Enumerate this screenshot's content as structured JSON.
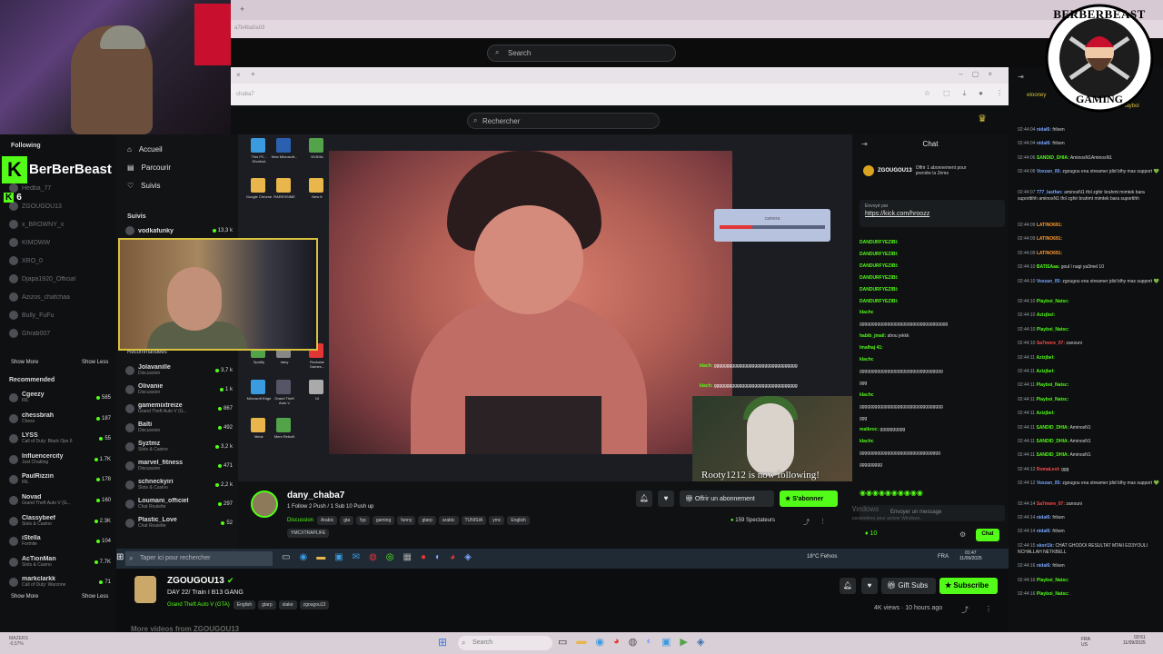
{
  "outer": {
    "search_placeholder": "Search",
    "addr_text": "a7b4ba0a03"
  },
  "inner": {
    "search_placeholder": "Rechercher",
    "addr_text": "chaba7"
  },
  "left_sidebar": {
    "following_title": "Following",
    "brand": "BerBerBeast",
    "brand_count": "6",
    "following": [
      {
        "name": "Hedba_77"
      },
      {
        "name": "ZGOUGOU13"
      },
      {
        "name": "x_BROWNY_x"
      },
      {
        "name": "KIMOWW"
      },
      {
        "name": "XRO_0"
      },
      {
        "name": "Djapa1920_Official"
      },
      {
        "name": "Azizos_chafchaa"
      },
      {
        "name": "Bully_FuFu"
      },
      {
        "name": "Ghrab007"
      }
    ],
    "show_more": "Show More",
    "show_less": "Show Less",
    "recommended_title": "Recommended",
    "recommended": [
      {
        "name": "Cgeezy",
        "sub": "IRL",
        "count": "585"
      },
      {
        "name": "chessbrah",
        "sub": "Chess",
        "count": "187"
      },
      {
        "name": "LYSS",
        "sub": "Call of Duty: Black Ops 6",
        "count": "55"
      },
      {
        "name": "Influencercity",
        "sub": "Just Chatting",
        "count": "1.7K"
      },
      {
        "name": "PaulRizzin",
        "sub": "IRL",
        "count": "178"
      },
      {
        "name": "Novad",
        "sub": "Grand Theft Auto V (G...",
        "count": "160"
      },
      {
        "name": "Classybeef",
        "sub": "Slots & Casino",
        "count": "2.3K"
      },
      {
        "name": "iStella",
        "sub": "Fortnite",
        "count": "104"
      },
      {
        "name": "AcTionMan",
        "sub": "Slots & Casino",
        "count": "7.7K"
      },
      {
        "name": "markclarkk",
        "sub": "Call of Duty: Warzone",
        "count": "71"
      }
    ],
    "show_more_2": "Show More",
    "show_less_2": "Show Less"
  },
  "mid_nav": {
    "items": [
      "Accueil",
      "Parcourir",
      "Suivis"
    ],
    "suivis_title": "Suivis",
    "first_channel": {
      "name": "vodkafunky",
      "count": "13,3 k"
    },
    "recommended_label": "Recommandées",
    "channels": [
      {
        "name": "Jolavanille",
        "sub": "Discussion",
        "count": "3,7 k"
      },
      {
        "name": "Olivanie",
        "sub": "Discussion",
        "count": "1 k"
      },
      {
        "name": "gamemixtreize",
        "sub": "Grand Theft Auto V (G...",
        "count": "867"
      },
      {
        "name": "Balti",
        "sub": "Discussion",
        "count": "492"
      },
      {
        "name": "Syztmz",
        "sub": "Slots & Casino",
        "count": "3,2 k"
      },
      {
        "name": "marvel_fitness",
        "sub": "Discussion",
        "count": "471"
      },
      {
        "name": "schneckyiri",
        "sub": "Slots & Casino",
        "count": "2,2 k"
      },
      {
        "name": "Loumani_officiel",
        "sub": "Chat Roulette",
        "count": "297"
      },
      {
        "name": "Plastic_Love",
        "sub": "Chat Roulette",
        "count": "52"
      }
    ]
  },
  "desktop_icons": [
    "This PC - Shortcut",
    "New Microsoft...",
    "NVIDIA",
    "Google Chrome",
    "RARESSIME",
    "New fr",
    "Spotify",
    "dany",
    "Rockstar Games...",
    "Microsoft Edge",
    "Grand Theft Auto V",
    "10",
    "tiktok",
    "Mem Rebuilt"
  ],
  "video_overlay": {
    "camera_label": "camera",
    "follow_text": "Rooty1212 is now following!",
    "chat_k1": "klach:",
    "chat_k2": "klach:"
  },
  "inner_chat": {
    "title": "Chat",
    "pinned_user": "ZGOUGOU13",
    "pinned_text": "Offrir 1 abonnement pour prendre la 2ème",
    "sent_by": "Envoyé par",
    "link": "https://kick.com/hroozz",
    "lines": [
      {
        "u": "DANDURFYEZIBI:",
        "t": ""
      },
      {
        "u": "DANDURFYEZIBI:",
        "t": ""
      },
      {
        "u": "DANDURFYEZIBI:",
        "t": ""
      },
      {
        "u": "DANDURFYEZIBI:",
        "t": ""
      },
      {
        "u": "DANDURFYEZIBI:",
        "t": ""
      },
      {
        "u": "DANDURFYEZIBI:",
        "t": ""
      },
      {
        "u": "klachc",
        "t": ""
      },
      {
        "u": "",
        "t": "ggggggggggggggggggggggggggggggggggg"
      },
      {
        "u": "habib_jmail:",
        "t": "ahou jekkk"
      },
      {
        "u": "lmalhaj 41:",
        "t": ""
      },
      {
        "u": "klachc",
        "t": ""
      },
      {
        "u": "",
        "t": "ggggggggggggggggggggggggggggggggg"
      },
      {
        "u": "",
        "t": "ggg"
      },
      {
        "u": "klachc",
        "t": ""
      },
      {
        "u": "",
        "t": "ggggggggggggggggggggggggggggggggg"
      },
      {
        "u": "",
        "t": "ggg"
      },
      {
        "u": "malbroc:",
        "t": "gggggggggg"
      },
      {
        "u": "klachc",
        "t": ""
      },
      {
        "u": "",
        "t": "gggggggggggggggggggggggggggggggg"
      },
      {
        "u": "",
        "t": "ggggggggg"
      }
    ],
    "send_placeholder": "Envoyer un message",
    "points": "10",
    "chat_btn": "Chat",
    "windows_activate": "Activer Windows",
    "windows_activate_sub": "Accédez aux paramètres pour activer Windows."
  },
  "stream_info": {
    "name": "dany_chaba7",
    "subtitle": "1 Follow 2 Push / 1 Sub 10 Push up",
    "category": "Discussion",
    "tags": [
      "Arabic",
      "gta",
      "fyp",
      "gaming",
      "funny",
      "gtarp",
      "arabic",
      "TUNISIA",
      "ymc",
      "English"
    ],
    "tag2": "YMCXTRAPLIFE",
    "gift_btn": "Offrir un abonnement",
    "subscribe_btn": "S'abonner",
    "viewers": "159 Spectateurs"
  },
  "inner_taskbar": {
    "search_placeholder": "Taper ici pour rechercher",
    "weather": "18°C Fehıos",
    "lang": "FRA",
    "time": "01:47",
    "date": "11/09/2025"
  },
  "outer_stream": {
    "name": "ZGOUGOU13",
    "title": "DAY 22/ Train I B13 GANG",
    "category": "Grand Theft Auto V (GTA)",
    "tags": [
      "English",
      "gtarp",
      "stake",
      "zgougou13"
    ],
    "gift_subs": "Gift Subs",
    "subscribe": "Subscribe",
    "views": "4K views",
    "ago": "10 hours ago",
    "more_videos": "More videos from ZGOUGOU13"
  },
  "outer_chat": {
    "top_user": "etooney",
    "top_user2": "Playboi",
    "lines": [
      {
        "time": "02:44:04",
        "user": "nidal6:",
        "color": "#7aa6ff",
        "text": "frilxen"
      },
      {
        "time": "02:44:04",
        "user": "nidal6:",
        "color": "#7aa6ff",
        "text": "frilxen"
      },
      {
        "time": "02:44:06",
        "user": "SANDID_DHIA:",
        "color": "#53fc18",
        "text": "AminosN1AminosN1"
      },
      {
        "time": "02:44:06",
        "user": "Voxzan_05:",
        "color": "#7aa6ff",
        "text": "zgougou ena streamer jdid blhy max support 💚"
      },
      {
        "time": "02:44:07",
        "user": "777_lastfan:",
        "color": "#7aa6ff",
        "text": "aminosN1 tfol zghir brahmt mimtek bara suporttihh aminosN1 tfol zghir brahmt mimtek bara suportihh"
      },
      {
        "time": "02:44:09",
        "user": "LATINO691:",
        "color": "#ff9b2e",
        "text": ""
      },
      {
        "time": "02:44:09",
        "user": "LATINO691:",
        "color": "#ff9b2e",
        "text": ""
      },
      {
        "time": "02:44:09",
        "user": "LATINO691:",
        "color": "#ff9b2e",
        "text": ""
      },
      {
        "time": "02:44:10",
        "user": "BATISAaa:",
        "color": "#53fc18",
        "text": "goul l nagi ya3mel 10"
      },
      {
        "time": "02:44:10",
        "user": "Voxzan_05:",
        "color": "#7aa6ff",
        "text": "zgougou ena streamer jdid blhy max support 💚"
      },
      {
        "time": "02:44:10",
        "user": "Playboi_Natsc:",
        "color": "#53fc18",
        "text": ""
      },
      {
        "time": "02:44:10",
        "user": "Azizjbel:",
        "color": "#53fc18",
        "text": ""
      },
      {
        "time": "02:44:10",
        "user": "Playboi_Natsc:",
        "color": "#53fc18",
        "text": ""
      },
      {
        "time": "02:44:10",
        "user": "Sa7more_07:",
        "color": "#ff4d4d",
        "text": "zanouni"
      },
      {
        "time": "02:44:11",
        "user": "Azizjbel:",
        "color": "#53fc18",
        "text": ""
      },
      {
        "time": "02:44:11",
        "user": "Azizjbel:",
        "color": "#53fc18",
        "text": ""
      },
      {
        "time": "02:44:11",
        "user": "Playboi_Natsc:",
        "color": "#53fc18",
        "text": ""
      },
      {
        "time": "02:44:11",
        "user": "Playboi_Natsc:",
        "color": "#53fc18",
        "text": ""
      },
      {
        "time": "02:44:11",
        "user": "Azizjbel:",
        "color": "#53fc18",
        "text": ""
      },
      {
        "time": "02:44:11",
        "user": "SANDID_DHIA:",
        "color": "#53fc18",
        "text": "AminosN1"
      },
      {
        "time": "02:44:11",
        "user": "SANDID_DHIA:",
        "color": "#53fc18",
        "text": "AminosN1"
      },
      {
        "time": "02:44:11",
        "user": "SANDID_DHIA:",
        "color": "#53fc18",
        "text": "AminosN1"
      },
      {
        "time": "02:44:12",
        "user": "RomaLeol:",
        "color": "#ff4d4d",
        "text": "ggg"
      },
      {
        "time": "02:44:12",
        "user": "Voxzan_05:",
        "color": "#7aa6ff",
        "text": "zgougou ena streamer jdid blhy max support 💚"
      },
      {
        "time": "02:44:14",
        "user": "Sa7more_07:",
        "color": "#ff4d4d",
        "text": "zanouni"
      },
      {
        "time": "02:44:14",
        "user": "nidal6:",
        "color": "#7aa6ff",
        "text": "frilxen"
      },
      {
        "time": "02:44:14",
        "user": "nidal6:",
        "color": "#7aa6ff",
        "text": "frilxen"
      },
      {
        "time": "02:44:15",
        "user": "skori1k:",
        "color": "#7aa6ff",
        "text": "CHAT GHODOI RESULTAT MTAII ED3YOULI NCHALLAH NETKBELL"
      },
      {
        "time": "02:44:16",
        "user": "nidal6:",
        "color": "#7aa6ff",
        "text": "frilxen"
      },
      {
        "time": "02:44:16",
        "user": "Playboi_Natsc:",
        "color": "#53fc18",
        "text": ""
      },
      {
        "time": "02:44:16",
        "user": "Playboi_Natsc:",
        "color": "#53fc18",
        "text": ""
      }
    ]
  },
  "logo_text": {
    "top": "BERBERBEAST",
    "bottom": "GAMING"
  },
  "outer_taskbar": {
    "left_text": "MAZERS",
    "left_sub": "-0,57%",
    "search": "Search",
    "lang": "FRA\nUS",
    "time": "03:51",
    "date": "11/09/2025"
  },
  "colors": {
    "kick_green": "#53fc18",
    "bg": "#0b0e0f"
  }
}
